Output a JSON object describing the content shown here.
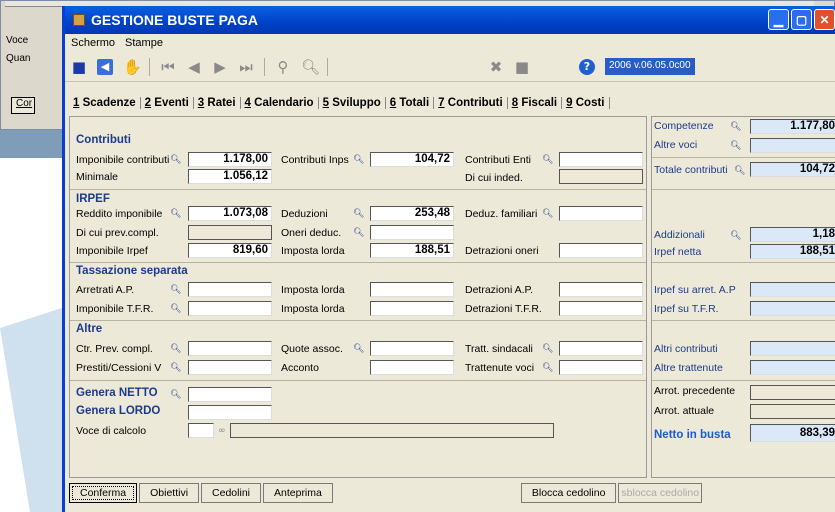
{
  "bg": {
    "label1": "Voce",
    "label2": "Quan",
    "btn": "Cor"
  },
  "window": {
    "title": "GESTIONE BUSTE PAGA",
    "accent": "#0a5fe0"
  },
  "menu": [
    "Schermo",
    "Stampe"
  ],
  "toolbar": {
    "version": "2006 v.06.05.0c00"
  },
  "tabs": [
    {
      "num": "1",
      "label": "Scadenze"
    },
    {
      "num": "2",
      "label": "Eventi"
    },
    {
      "num": "3",
      "label": "Ratei"
    },
    {
      "num": "4",
      "label": "Calendario"
    },
    {
      "num": "5",
      "label": "Sviluppo"
    },
    {
      "num": "6",
      "label": "Totali"
    },
    {
      "num": "7",
      "label": "Contributi"
    },
    {
      "num": "8",
      "label": "Fiscali"
    },
    {
      "num": "9",
      "label": "Costi"
    }
  ],
  "contributi": {
    "title": "Contributi",
    "imponibile_label": "Imponibile contributi",
    "imponibile_value": "1.178,00",
    "inps_label": "Contributi Inps",
    "inps_value": "104,72",
    "enti_label": "Contributi Enti",
    "minimale_label": "Minimale",
    "minimale_value": "1.056,12",
    "inded_label": "Di cui inded."
  },
  "irpef": {
    "title": "IRPEF",
    "reddito_label": "Reddito imponibile",
    "reddito_value": "1.073,08",
    "deduzioni_label": "Deduzioni",
    "deduzioni_value": "253,48",
    "deduz_fam_label": "Deduz. familiari",
    "prev_label": "Di cui prev.compl.",
    "oneri_label": "Oneri deduc.",
    "imp_irpef_label": "Imponibile Irpef",
    "imp_irpef_value": "819,60",
    "imposta_label": "Imposta lorda",
    "imposta_value": "188,51",
    "detr_label": "Detrazioni oneri"
  },
  "tassazione": {
    "title": "Tassazione separata",
    "arretrati": "Arretrati A.P.",
    "imposta1": "Imposta lorda",
    "detr_ap": "Detrazioni A.P.",
    "tfr": "Imponibile T.F.R.",
    "imposta2": "Imposta lorda",
    "detr_tfr": "Detrazioni T.F.R."
  },
  "altre": {
    "title": "Altre",
    "ctr": "Ctr. Prev. compl.",
    "quote": "Quote assoc.",
    "tratt_sind": "Tratt. sindacali",
    "prestiti": "Prestiti/Cessioni V",
    "acconto": "Acconto",
    "tratt_voci": "Trattenute voci"
  },
  "genera": {
    "netto": "Genera NETTO",
    "lordo": "Genera LORDO",
    "voce": "Voce di calcolo"
  },
  "right": {
    "competenze": "Competenze",
    "competenze_value": "1.177,80",
    "altre_voci": "Altre voci",
    "totale": "Totale contributi",
    "totale_value": "104,72",
    "addizionali": "Addizionali",
    "addizionali_value": "1,18",
    "irpef_netta": "Irpef netta",
    "irpef_netta_value": "188,51",
    "irpef_arret": "Irpef su arret. A.P",
    "irpef_tfr": "Irpef su T.F.R.",
    "altri_contr": "Altri contributi",
    "altre_tratt": "Altre trattenute",
    "arrot_prec": "Arrot. precedente",
    "arrot_att": "Arrot. attuale",
    "netto": "Netto in busta",
    "netto_value": "883,39"
  },
  "buttons": {
    "conferma": "Conferma",
    "obiettivi": "Obiettivi",
    "cedolini": "Cedolini",
    "anteprima": "Anteprima",
    "blocca": "Blocca cedolino",
    "sblocca": "sblocca cedolino"
  }
}
